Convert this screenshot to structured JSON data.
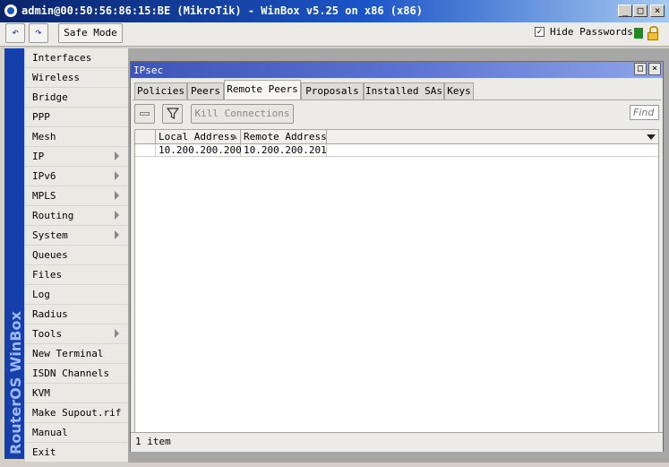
{
  "window": {
    "title": "admin@00:50:56:86:15:BE (MikroTik) - WinBox v5.25 on x86 (x86)"
  },
  "toolbar": {
    "safe_mode": "Safe Mode",
    "hide_passwords": "Hide Passwords",
    "hide_passwords_checked": true
  },
  "brand": "RouterOS WinBox",
  "sidebar": {
    "items": [
      {
        "label": "Interfaces",
        "submenu": false
      },
      {
        "label": "Wireless",
        "submenu": false
      },
      {
        "label": "Bridge",
        "submenu": false
      },
      {
        "label": "PPP",
        "submenu": false
      },
      {
        "label": "Mesh",
        "submenu": false
      },
      {
        "label": "IP",
        "submenu": true
      },
      {
        "label": "IPv6",
        "submenu": true
      },
      {
        "label": "MPLS",
        "submenu": true
      },
      {
        "label": "Routing",
        "submenu": true
      },
      {
        "label": "System",
        "submenu": true
      },
      {
        "label": "Queues",
        "submenu": false
      },
      {
        "label": "Files",
        "submenu": false
      },
      {
        "label": "Log",
        "submenu": false
      },
      {
        "label": "Radius",
        "submenu": false
      },
      {
        "label": "Tools",
        "submenu": true
      },
      {
        "label": "New Terminal",
        "submenu": false
      },
      {
        "label": "ISDN Channels",
        "submenu": false
      },
      {
        "label": "KVM",
        "submenu": false
      },
      {
        "label": "Make Supout.rif",
        "submenu": false
      },
      {
        "label": "Manual",
        "submenu": false
      },
      {
        "label": "Exit",
        "submenu": false
      }
    ]
  },
  "ipsec": {
    "title": "IPsec",
    "tabs": [
      {
        "label": "Policies"
      },
      {
        "label": "Peers"
      },
      {
        "label": "Remote Peers",
        "active": true
      },
      {
        "label": "Proposals"
      },
      {
        "label": "Installed SAs"
      },
      {
        "label": "Keys"
      }
    ],
    "kill_connections": "Kill Connections",
    "find_placeholder": "Find",
    "columns": [
      "Local Address",
      "Remote Address"
    ],
    "rows": [
      [
        "10.200.200.200",
        "10.200.200.201"
      ]
    ],
    "status": "1 item"
  },
  "colors": {
    "title_bar": "#0a246a",
    "brand_bar": "#1540ac",
    "status_green": "#1f8a1f"
  },
  "icons": {
    "app": "winbox-app-icon",
    "undo": "undo-icon",
    "redo": "redo-icon",
    "lock": "lock-icon",
    "remove": "remove-icon",
    "filter": "filter-icon",
    "sort": "sort-ascending-icon",
    "column_menu": "column-menu-icon"
  }
}
